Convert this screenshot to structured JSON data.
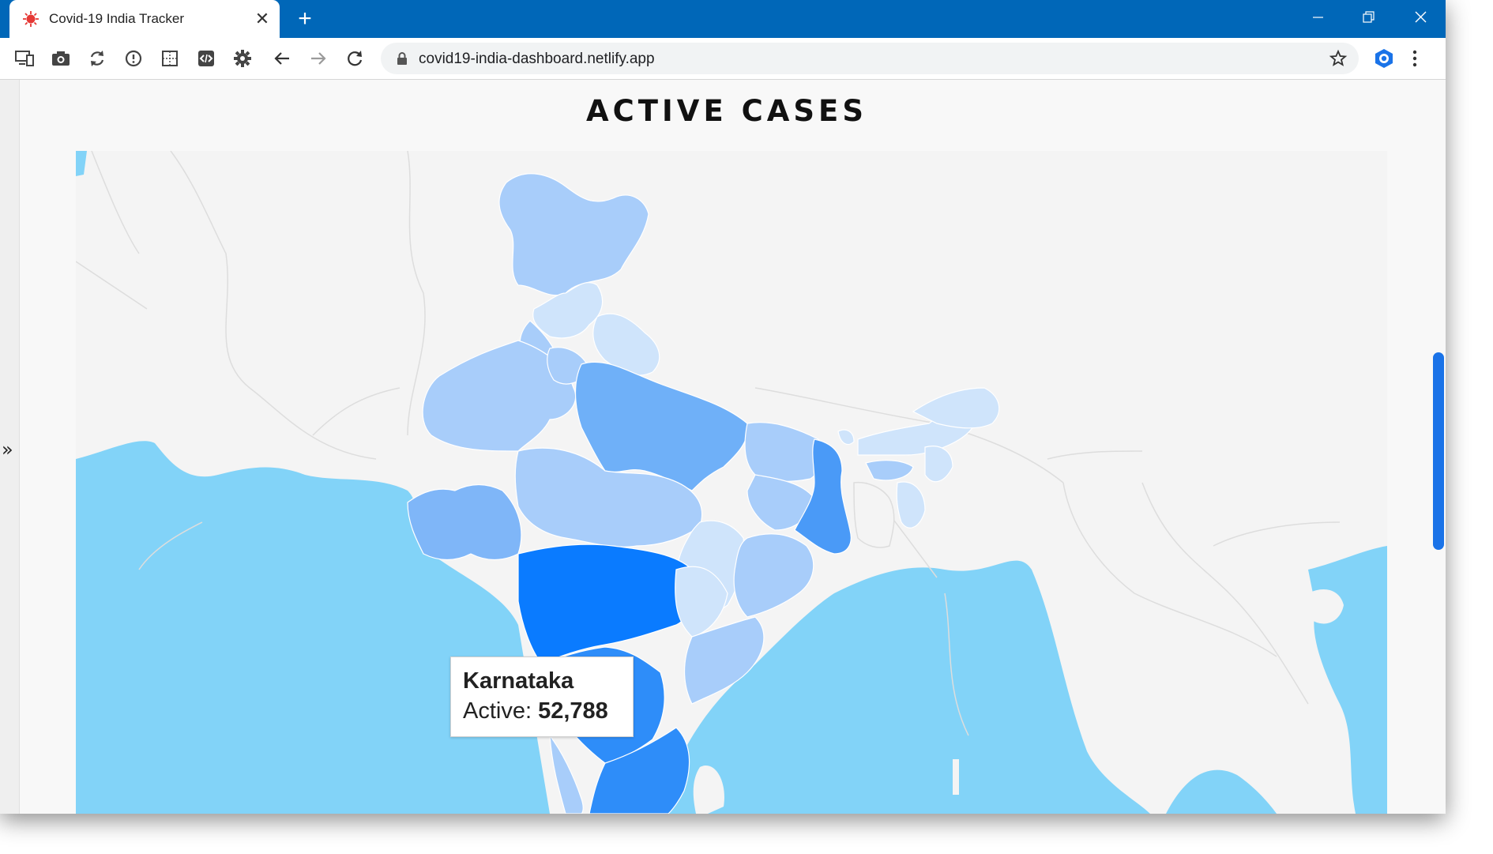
{
  "browser": {
    "tab_title": "Covid-19 India Tracker",
    "url": "covid19-india-dashboard.netlify.app"
  },
  "page": {
    "title": "ACTIVE CASES"
  },
  "tooltip": {
    "state": "Karnataka",
    "label": "Active:",
    "value": "52,788"
  },
  "colors": {
    "titlebar": "#0067b8",
    "sea": "#82d3f8",
    "land": "#f4f4f4",
    "border": "#dddddd",
    "highlight": "#0a7bff",
    "scrollbar": "#1a73e8"
  },
  "map_legend_scale": [
    "#cfe4fb",
    "#a8cdfa",
    "#7fb6f8",
    "#4a9af7",
    "#0a7bff"
  ]
}
